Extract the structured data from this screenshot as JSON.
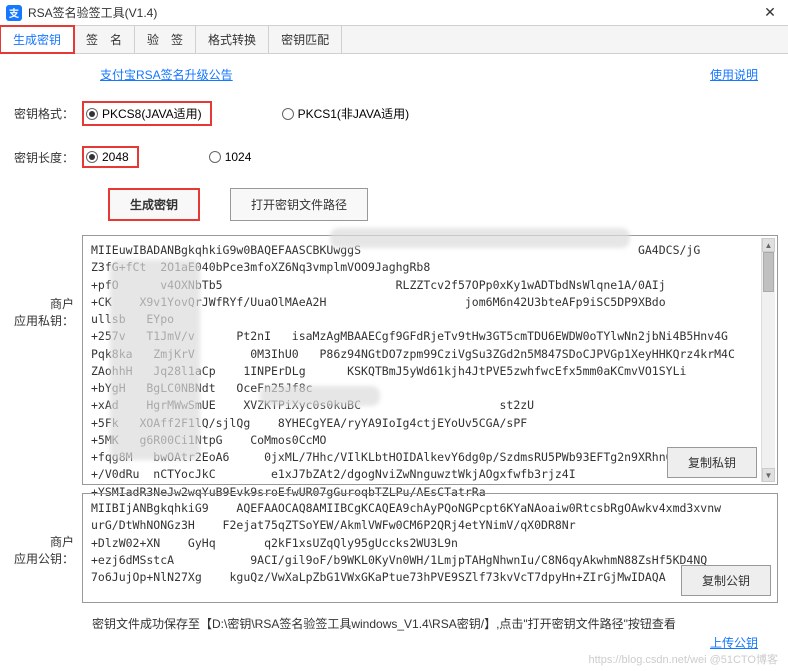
{
  "window": {
    "logo_char": "支",
    "title": "RSA签名验签工具(V1.4)",
    "close": "✕"
  },
  "tabs": {
    "t1": "生成密钥",
    "t2": "签　名",
    "t3": "验　签",
    "t4": "格式转换",
    "t5": "密钥匹配"
  },
  "links": {
    "notice": "支付宝RSA签名升级公告",
    "help": "使用说明",
    "upload": "上传公钥"
  },
  "form": {
    "format_label": "密钥格式：",
    "format_opt1": "PKCS8(JAVA适用)",
    "format_opt2": "PKCS1(非JAVA适用)",
    "length_label": "密钥长度：",
    "length_opt1": "2048",
    "length_opt2": "1024"
  },
  "buttons": {
    "generate": "生成密钥",
    "open_path": "打开密钥文件路径",
    "copy_private": "复制私钥",
    "copy_public": "复制公钥"
  },
  "labels": {
    "private": "商户\n应用私钥：",
    "public": "商户\n应用公钥："
  },
  "keys": {
    "private_text": "MIIEuwIBADANBgkqhkiG9w0BAQEFAASCBKUwggS                                        GA4DCS/jG\nZ3fG+fCt  2O1aE040bPce3mfoXZ6Nq3vmplmVOO9JaghgRb8                                    \n+pfO      v4OXNbTb5                         RLZZTcv2f57OPp0xKy1wADTbdNsWlqne1A/0AIj\n+CK    X9v1YovQrJWfRYf/UuaOlMAeA2H                    jom6M6n42U3bteAFp9iSC5DP9XBdo\nullsb   EYpo\n+257v   T1JmV/v      Pt2nI   isaMzAgMBAAECgf9GFdRjeTv9tHw3GT5cmTDU6EWDW0oTYlwNn2jbNi4B5Hnv4G\nPqk8ka   ZmjKrV        0M3IhU0   P86z94NGtDO7zpm99CziVgSu3ZGd2n5M847SDoCJPVGp1XeyHHKQrz4krM4C\nZAohhH   Jq28l1aCp    1INPErDLg      KSKQTBmJ5yWd61kjh4JtPVE5zwhfwcEfx5mm0aKCmvVO1SYLi\n+bYgH   BgLC0NBNdt   OceFn25Jf8c\n+xAd    HgrMWwSmUE    XVZKTPiXyc0s0kuBC                    st2zU\n+5Fk   XOAff2F1lQ/sjlQg    8YHECgYEA/ryYA9IoIg4ctjEYoUv5CGA/sPF     \n+5MK   g6R00Ci1NtpG    CoMmos0CcMO\n+fqg8M   bwOAtr2EoA6     0jxML/7Hhc/VIlKLbtHOIDAlkevY6dg0p/SzdmsRU5PWb93EFTg2n9XRhn0\n+/V0dRu  nCTYocJkC        e1xJ7bZAt2/dgogNviZwNnguwztWkjAOgxfwfb3rjz4I\n+YSMIadR3NeJw2wqYuB9Evk9sroEfwUR07gGuroqbTZLPu/AEsCTatrRa",
    "public_text": "MIIBIjANBgkqhkiG9    AQEFAAOCAQ8AMIIBCgKCAQEA9chAyPQoNGPcpt6KYaNAoaiw0RtcsbRgOAwkv4xmd3xvnw\nurG/DtWhNONGz3H    F2ejat75qZTSoYEW/AkmlVWFw0CM6P2QRj4etYNimV/qX0DR8Nr\n+DlzW02+XN    GyHq       q2kF1xsUZqQly95gUccks2WU3L9n\n+ezj6dMSstcA           9ACI/gil9oF/b9WKL0KyVn0WH/1LmjpTAHgNhwnIu/C8N6qyAkwhmN88ZsHf5KD4NQ\n7o6JujOp+NlN27Xg    kguQz/VwXaLpZbG1VWxGKaPtue73hPVE9SZlf73kvVcT7dpyHn+ZIrGjMwIDAQA"
  },
  "footer": {
    "msg": "密钥文件成功保存至【D:\\密钥\\RSA签名验签工具windows_V1.4\\RSA密钥/】,点击\"打开密钥文件路径\"按钮查看"
  },
  "watermark": "https://blog.csdn.net/wei  @51CTO博客"
}
